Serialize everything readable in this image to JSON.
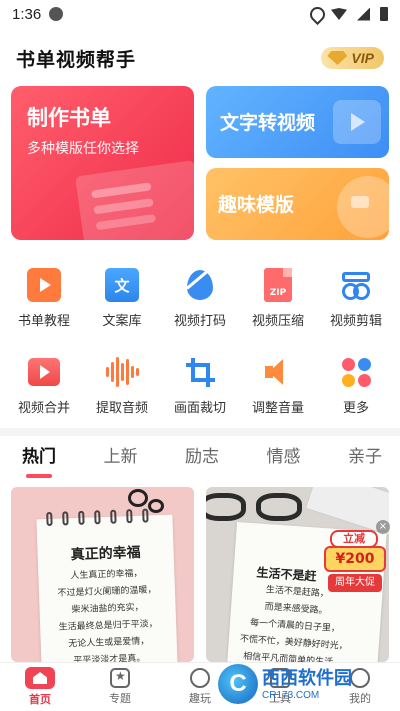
{
  "status_bar": {
    "time": "1:36"
  },
  "header": {
    "title": "书单视频帮手",
    "vip_label": "VIP"
  },
  "hero": {
    "main": {
      "title": "制作书单",
      "subtitle": "多种模版任你选择"
    },
    "card_top": {
      "title": "文字转视频"
    },
    "card_bottom": {
      "title": "趣味模版"
    }
  },
  "tools": {
    "row1": [
      {
        "label": "书单教程",
        "icon": "book-play-icon"
      },
      {
        "label": "文案库",
        "icon": "text-doc-icon"
      },
      {
        "label": "视频打码",
        "icon": "mosaic-drop-icon"
      },
      {
        "label": "视频压缩",
        "icon": "zip-file-icon"
      },
      {
        "label": "视频剪辑",
        "icon": "scissors-icon"
      }
    ],
    "row2": [
      {
        "label": "视频合并",
        "icon": "video-merge-icon"
      },
      {
        "label": "提取音频",
        "icon": "audio-wave-icon"
      },
      {
        "label": "画面裁切",
        "icon": "crop-icon"
      },
      {
        "label": "调整音量",
        "icon": "volume-icon"
      },
      {
        "label": "更多",
        "icon": "more-dots-icon"
      }
    ],
    "wen_glyph": "文",
    "zip_glyph": "ZIP"
  },
  "tabs": [
    "热门",
    "上新",
    "励志",
    "情感",
    "亲子"
  ],
  "active_tab": "热门",
  "cards": {
    "left": {
      "title": "真正的幸福",
      "lines": [
        "人生真正的幸福，",
        "不过是灯火阑珊的温暖，",
        "柴米油盐的充实，",
        "生活最终总是归于平淡，",
        "无论人生或是爱情，",
        "平平淡淡才是真。"
      ]
    },
    "right": {
      "title": "生活不是赶",
      "lines": [
        "生活不是赶路，",
        "而是来感受路。",
        "每一个清晨的日子里，",
        "不慌不忙，美好静好时光，",
        "相信平凡而简单的生活。"
      ]
    }
  },
  "promo": {
    "top": "立减",
    "amount": "¥200",
    "footer": "周年大促",
    "close": "×"
  },
  "bottom_nav": [
    {
      "label": "首页",
      "icon": "home-icon"
    },
    {
      "label": "专题",
      "icon": "star-icon"
    },
    {
      "label": "趣玩",
      "icon": "play-icon"
    },
    {
      "label": "工具",
      "icon": "tool-icon"
    },
    {
      "label": "我的",
      "icon": "user-icon"
    }
  ],
  "watermark": {
    "logo": "C",
    "name": "西西软件园",
    "domain": "CR173.COM"
  },
  "colors": {
    "accent": "#ff4a5c",
    "hero_red": "#f02c4a",
    "hero_blue": "#3d8ef5",
    "hero_orange": "#ffa23a"
  }
}
